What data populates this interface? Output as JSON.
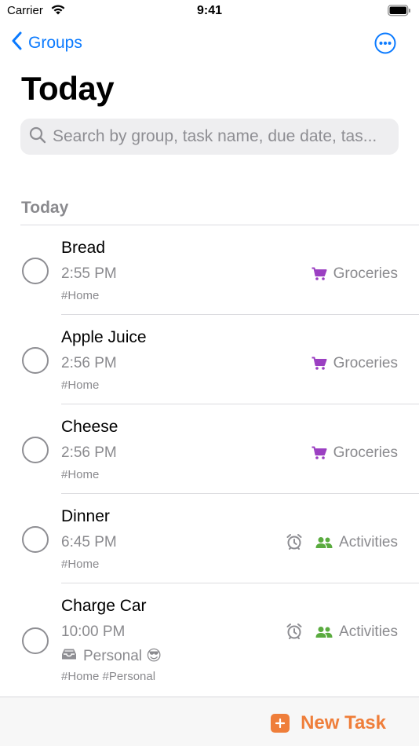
{
  "status_bar": {
    "carrier": "Carrier",
    "time": "9:41"
  },
  "nav": {
    "back_label": "Groups"
  },
  "page_title": "Today",
  "search": {
    "placeholder": "Search by group, task name, due date, tas..."
  },
  "section": {
    "title": "Today"
  },
  "tasks": [
    {
      "name": "Bread",
      "time": "2:55 PM",
      "tags": "#Home",
      "group": "Groceries",
      "group_icon": "cart-icon",
      "has_alarm": false
    },
    {
      "name": "Apple Juice",
      "time": "2:56 PM",
      "tags": "#Home",
      "group": "Groceries",
      "group_icon": "cart-icon",
      "has_alarm": false
    },
    {
      "name": "Cheese",
      "time": "2:56 PM",
      "tags": "#Home",
      "group": "Groceries",
      "group_icon": "cart-icon",
      "has_alarm": false
    },
    {
      "name": "Dinner",
      "time": "6:45 PM",
      "tags": "#Home",
      "group": "Activities",
      "group_icon": "people-icon",
      "has_alarm": true
    },
    {
      "name": "Charge Car",
      "time": "10:00 PM",
      "extra": "Personal 😎",
      "extra_icon": "inbox-icon",
      "tags": "#Home #Personal",
      "group": "Activities",
      "group_icon": "people-icon",
      "has_alarm": true
    }
  ],
  "bottom": {
    "new_task_label": "New Task"
  },
  "colors": {
    "accent_blue": "#0a7aff",
    "accent_orange": "#ef7e3a",
    "groceries_purple": "#9b3fc2",
    "activities_green": "#5aab3f",
    "secondary_text": "#8a8a8e"
  }
}
